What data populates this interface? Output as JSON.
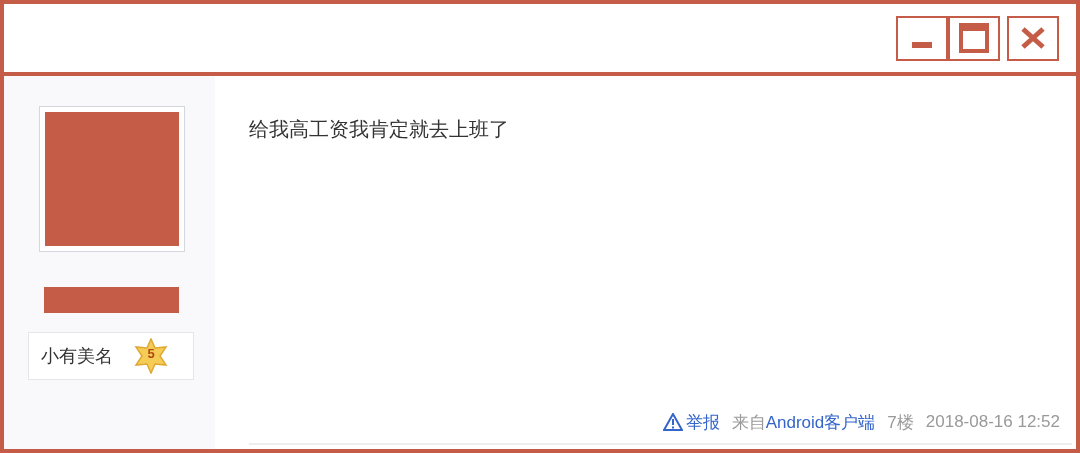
{
  "user": {
    "level_title": "小有美名",
    "level_number": "5"
  },
  "post": {
    "text": "给我高工资我肯定就去上班了"
  },
  "footer": {
    "report": "举报",
    "source_prefix": "来自",
    "source_link": "Android客户端",
    "floor": "7楼",
    "time": "2018-08-16 12:52"
  }
}
